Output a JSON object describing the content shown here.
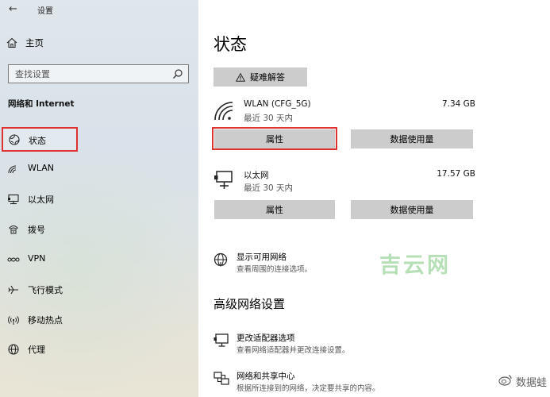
{
  "window": {
    "title": "设置"
  },
  "sidebar": {
    "home_label": "主页",
    "search_placeholder": "查找设置",
    "section_title": "网络和 Internet",
    "items": [
      {
        "label": "状态",
        "icon": "globe-icon",
        "selected": true
      },
      {
        "label": "WLAN",
        "icon": "wifi-icon"
      },
      {
        "label": "以太网",
        "icon": "ethernet-icon"
      },
      {
        "label": "拨号",
        "icon": "dialup-icon"
      },
      {
        "label": "VPN",
        "icon": "vpn-icon"
      },
      {
        "label": "飞行模式",
        "icon": "airplane-icon"
      },
      {
        "label": "移动热点",
        "icon": "hotspot-icon"
      },
      {
        "label": "代理",
        "icon": "proxy-globe-icon"
      }
    ]
  },
  "main": {
    "title": "状态",
    "troubleshoot_label": "疑难解答",
    "networks": [
      {
        "name": "WLAN (CFG_5G)",
        "period": "最近 30 天内",
        "usage": "7.34 GB",
        "properties_label": "属性",
        "data_usage_label": "数据使用量",
        "icon": "wifi-signal-icon"
      },
      {
        "name": "以太网",
        "period": "最近 30 天内",
        "usage": "17.57 GB",
        "properties_label": "属性",
        "data_usage_label": "数据使用量",
        "icon": "ethernet-monitor-icon"
      }
    ],
    "show_networks": {
      "title": "显示可用网络",
      "desc": "查看周围的连接选项。"
    },
    "advanced_heading": "高级网络设置",
    "adapter_options": {
      "title": "更改适配器选项",
      "desc": "查看网络适配器并更改连接设置。"
    },
    "sharing_center": {
      "title": "网络和共享中心",
      "desc": "根据所连接到的网络，决定要共享的内容。"
    }
  },
  "watermark": {
    "text": "吉云网"
  },
  "weibo_watermark": {
    "text": "数据蛙"
  },
  "colors": {
    "highlight": "#e03131",
    "button_bg": "#cccccc",
    "watermark_green": "#3caa3c"
  }
}
